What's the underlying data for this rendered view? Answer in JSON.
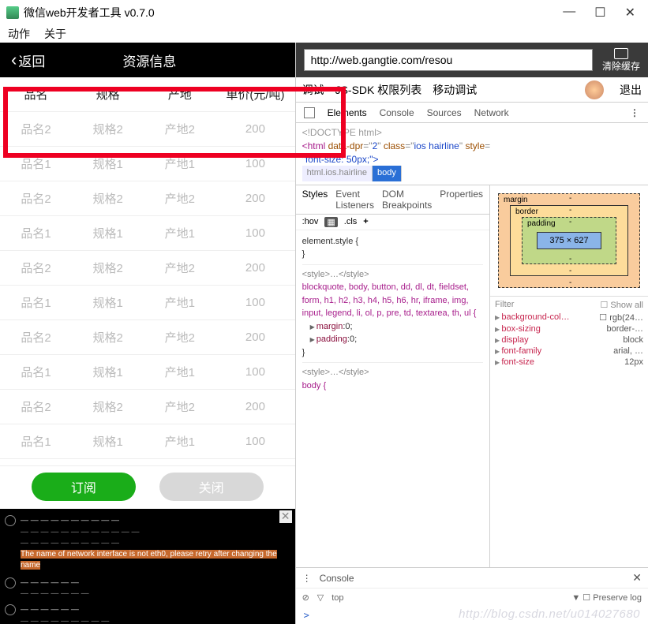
{
  "window": {
    "title": "微信web开发者工具 v0.7.0",
    "menu": [
      "动作",
      "关于"
    ],
    "controls": {
      "min": "—",
      "max": "☐",
      "close": "✕"
    }
  },
  "sim": {
    "back": "返回",
    "title": "资源信息",
    "header": [
      "品名",
      "规格",
      "产地",
      "单价(元/吨)"
    ],
    "rows": [
      [
        "品名2",
        "规格2",
        "产地2",
        "200"
      ],
      [
        "品名1",
        "规格1",
        "产地1",
        "100"
      ],
      [
        "品名2",
        "规格2",
        "产地2",
        "200"
      ],
      [
        "品名1",
        "规格1",
        "产地1",
        "100"
      ],
      [
        "品名2",
        "规格2",
        "产地2",
        "200"
      ],
      [
        "品名1",
        "规格1",
        "产地1",
        "100"
      ],
      [
        "品名2",
        "规格2",
        "产地2",
        "200"
      ],
      [
        "品名1",
        "规格1",
        "产地1",
        "100"
      ],
      [
        "品名2",
        "规格2",
        "产地2",
        "200"
      ],
      [
        "品名1",
        "规格1",
        "产地1",
        "100"
      ]
    ],
    "subscribe": "订阅",
    "close": "关闭",
    "log_warning": "The name of network interface is not eth0, please retry after changing the name"
  },
  "dev": {
    "url": "http://web.gangtie.com/resou",
    "clear_cache": "清除缓存",
    "topTabs": {
      "debug": "调试",
      "jssdk": "JS-SDK 权限列表",
      "mobile": "移动调试",
      "logout": "退出"
    },
    "devTabs": [
      "Elements",
      "Console",
      "Sources",
      "Network"
    ],
    "html1": "<!DOCTYPE html>",
    "html2a": "<html ",
    "html2b": "data-dpr",
    "html2c": "=\"",
    "html2d": "2",
    "html2e": "\" ",
    "html2f": "class",
    "html2g": "=\"",
    "html2h": "ios hairline",
    "html2i": "\" ",
    "html2j": "style",
    "html2k": "=",
    "html3": "\"font-size: 50px;\">",
    "crumbs": [
      "html.ios.hairline",
      "body"
    ],
    "styleTabs": [
      "Styles",
      "Event Listeners",
      "DOM Breakpoints",
      "Properties"
    ],
    "hov": ":hov",
    "cls": ".cls",
    "styleText": {
      "l1": "element.style {",
      "l2": "}",
      "l3": "<style>…</style>",
      "l4": "blockquote, body, button, dd, dl, dt, fieldset, form, h1, h2, h3, h4, h5, h6, hr, iframe, img, input, legend, li, ol, p, pre, td, textarea, th, ul {",
      "p1": "margin",
      "p1v": "0",
      "p2": "padding",
      "p2v": "0",
      "l5": "}",
      "l6": "<style>…</style>",
      "l7": "body {"
    },
    "box": {
      "margin": "margin",
      "border": "border",
      "padding": "padding",
      "content": "375 × 627",
      "dash": "-"
    },
    "computed": {
      "filter": "Filter",
      "showall": "Show all",
      "rows": [
        {
          "k": "background-col…",
          "v": "☐ rgb(24…"
        },
        {
          "k": "box-sizing",
          "v": "border-…"
        },
        {
          "k": "display",
          "v": "block"
        },
        {
          "k": "font-family",
          "v": "arial, …"
        },
        {
          "k": "font-size",
          "v": "12px"
        }
      ]
    },
    "consoleTab": "Console",
    "top": "top",
    "preserve": "Preserve log",
    "prompt": ">"
  },
  "watermark": "http://blog.csdn.net/u014027680"
}
